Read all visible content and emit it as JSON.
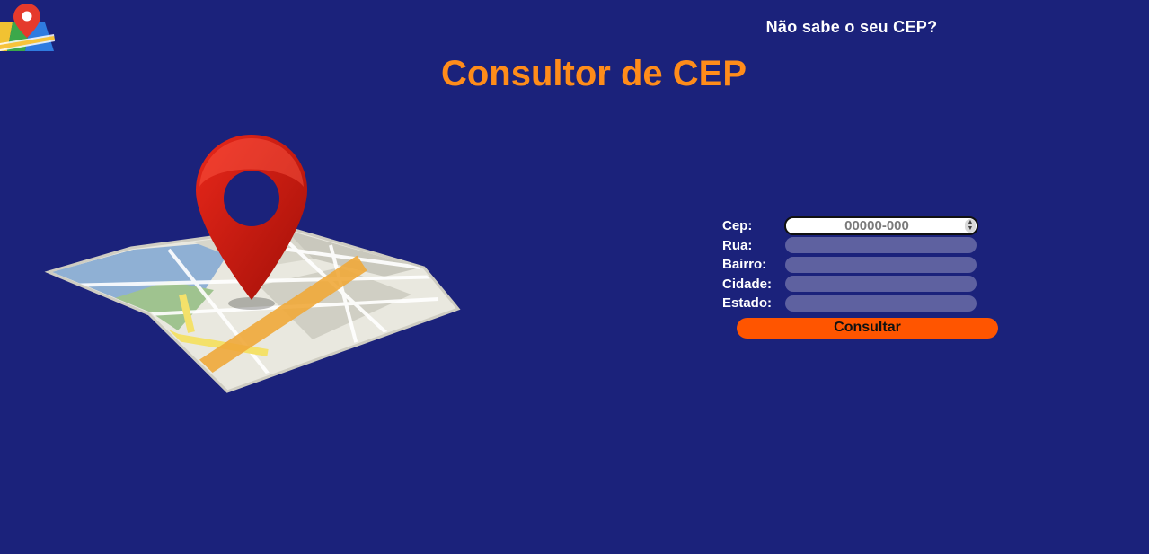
{
  "header": {
    "logo_icon": "map-pin-logo-icon",
    "help_link": "Não sabe o seu CEP?"
  },
  "main": {
    "title": "Consultor de CEP",
    "illustration_icon": "map-with-location-pin-icon"
  },
  "form": {
    "cep": {
      "label": "Cep:",
      "placeholder": "00000-000",
      "value": ""
    },
    "rua": {
      "label": "Rua:",
      "value": ""
    },
    "bairro": {
      "label": "Bairro:",
      "value": ""
    },
    "cidade": {
      "label": "Cidade:",
      "value": ""
    },
    "estado": {
      "label": "Estado:",
      "value": ""
    },
    "submit_label": "Consultar"
  },
  "colors": {
    "background": "#1b227b",
    "title": "#ff8c1a",
    "button": "#ff5500",
    "readonly_field": "#5e61a0"
  }
}
